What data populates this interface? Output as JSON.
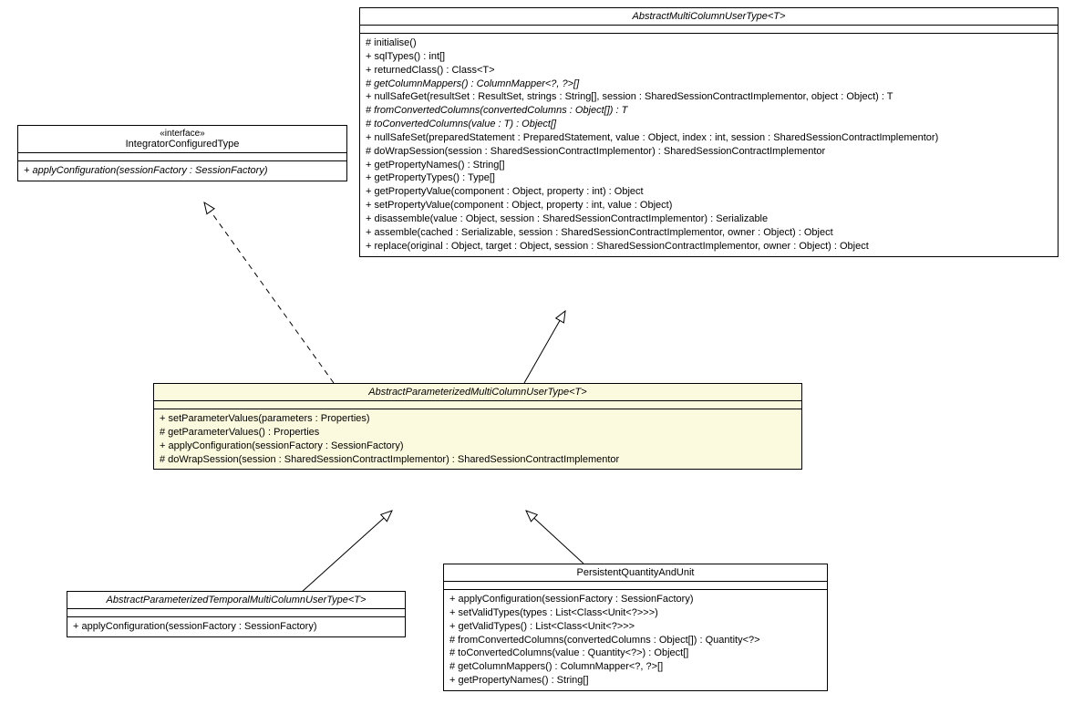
{
  "chart_data": {
    "type": "uml-class-diagram",
    "classes": [
      {
        "id": "IntegratorConfiguredType",
        "stereotype": "«interface»",
        "abstract": false,
        "methods": [
          "+ applyConfiguration(sessionFactory : SessionFactory)"
        ]
      },
      {
        "id": "AbstractMultiColumnUserType",
        "title": "AbstractMultiColumnUserType<T>",
        "abstract": true,
        "methods": [
          "# initialise()",
          "+ sqlTypes() : int[]",
          "+ returnedClass() : Class<T>",
          "# getColumnMappers() : ColumnMapper<?, ?>[]",
          "+ nullSafeGet(resultSet : ResultSet, strings : String[], session : SharedSessionContractImplementor, object : Object) : T",
          "# fromConvertedColumns(convertedColumns : Object[]) : T",
          "# toConvertedColumns(value : T) : Object[]",
          "+ nullSafeSet(preparedStatement : PreparedStatement, value : Object, index : int, session : SharedSessionContractImplementor)",
          "# doWrapSession(session : SharedSessionContractImplementor) : SharedSessionContractImplementor",
          "+ getPropertyNames() : String[]",
          "+ getPropertyTypes() : Type[]",
          "+ getPropertyValue(component : Object, property : int) : Object",
          "+ setPropertyValue(component : Object, property : int, value : Object)",
          "+ disassemble(value : Object, session : SharedSessionContractImplementor) : Serializable",
          "+ assemble(cached : Serializable, session : SharedSessionContractImplementor, owner : Object) : Object",
          "+ replace(original : Object, target : Object, session : SharedSessionContractImplementor, owner : Object) : Object"
        ]
      },
      {
        "id": "AbstractParameterizedMultiColumnUserType",
        "title": "AbstractParameterizedMultiColumnUserType<T>",
        "abstract": true,
        "highlighted": true,
        "methods": [
          "+ setParameterValues(parameters : Properties)",
          "# getParameterValues() : Properties",
          "+ applyConfiguration(sessionFactory : SessionFactory)",
          "# doWrapSession(session : SharedSessionContractImplementor) : SharedSessionContractImplementor"
        ]
      },
      {
        "id": "AbstractParameterizedTemporalMultiColumnUserType",
        "title": "AbstractParameterizedTemporalMultiColumnUserType<T>",
        "abstract": true,
        "methods": [
          "+ applyConfiguration(sessionFactory : SessionFactory)"
        ]
      },
      {
        "id": "PersistentQuantityAndUnit",
        "title": "PersistentQuantityAndUnit",
        "abstract": false,
        "methods": [
          "+ applyConfiguration(sessionFactory : SessionFactory)",
          "+ setValidTypes(types : List<Class<Unit<?>>>)",
          "+ getValidTypes() : List<Class<Unit<?>>>",
          "# fromConvertedColumns(convertedColumns : Object[]) : Quantity<?>",
          "# toConvertedColumns(value : Quantity<?>) : Object[]",
          "# getColumnMappers() : ColumnMapper<?, ?>[]",
          "+ getPropertyNames() : String[]"
        ]
      }
    ],
    "relationships": [
      {
        "from": "AbstractParameterizedMultiColumnUserType",
        "to": "IntegratorConfiguredType",
        "type": "realization"
      },
      {
        "from": "AbstractParameterizedMultiColumnUserType",
        "to": "AbstractMultiColumnUserType",
        "type": "generalization"
      },
      {
        "from": "AbstractParameterizedTemporalMultiColumnUserType",
        "to": "AbstractParameterizedMultiColumnUserType",
        "type": "generalization"
      },
      {
        "from": "PersistentQuantityAndUnit",
        "to": "AbstractParameterizedMultiColumnUserType",
        "type": "generalization"
      }
    ]
  },
  "classes": {
    "integrator": {
      "stereotype": "«interface»",
      "name": "IntegratorConfiguredType",
      "m0": "+ applyConfiguration(sessionFactory : SessionFactory)"
    },
    "abstractMulti": {
      "name": "AbstractMultiColumnUserType<T>",
      "m0": "# initialise()",
      "m1": "+ sqlTypes() : int[]",
      "m2": "+ returnedClass() : Class<T>",
      "m3": "# getColumnMappers() : ColumnMapper<?, ?>[]",
      "m4": "+ nullSafeGet(resultSet : ResultSet, strings : String[], session : SharedSessionContractImplementor, object : Object) : T",
      "m5": "# fromConvertedColumns(convertedColumns : Object[]) : T",
      "m6": "# toConvertedColumns(value : T) : Object[]",
      "m7": "+ nullSafeSet(preparedStatement : PreparedStatement, value : Object, index : int, session : SharedSessionContractImplementor)",
      "m8": "# doWrapSession(session : SharedSessionContractImplementor) : SharedSessionContractImplementor",
      "m9": "+ getPropertyNames() : String[]",
      "m10": "+ getPropertyTypes() : Type[]",
      "m11": "+ getPropertyValue(component : Object, property : int) : Object",
      "m12": "+ setPropertyValue(component : Object, property : int, value : Object)",
      "m13": "+ disassemble(value : Object, session : SharedSessionContractImplementor) : Serializable",
      "m14": "+ assemble(cached : Serializable, session : SharedSessionContractImplementor, owner : Object) : Object",
      "m15": "+ replace(original : Object, target : Object, session : SharedSessionContractImplementor, owner : Object) : Object"
    },
    "abstractParam": {
      "name": "AbstractParameterizedMultiColumnUserType<T>",
      "m0": "+ setParameterValues(parameters : Properties)",
      "m1": "# getParameterValues() : Properties",
      "m2": "+ applyConfiguration(sessionFactory : SessionFactory)",
      "m3": "# doWrapSession(session : SharedSessionContractImplementor) : SharedSessionContractImplementor"
    },
    "abstractParamTemporal": {
      "name": "AbstractParameterizedTemporalMultiColumnUserType<T>",
      "m0": "+ applyConfiguration(sessionFactory : SessionFactory)"
    },
    "persistent": {
      "name": "PersistentQuantityAndUnit",
      "m0": "+ applyConfiguration(sessionFactory : SessionFactory)",
      "m1": "+ setValidTypes(types : List<Class<Unit<?>>>)",
      "m2": "+ getValidTypes() : List<Class<Unit<?>>>",
      "m3": "# fromConvertedColumns(convertedColumns : Object[]) : Quantity<?>",
      "m4": "# toConvertedColumns(value : Quantity<?>) : Object[]",
      "m5": "# getColumnMappers() : ColumnMapper<?, ?>[]",
      "m6": "+ getPropertyNames() : String[]"
    }
  }
}
